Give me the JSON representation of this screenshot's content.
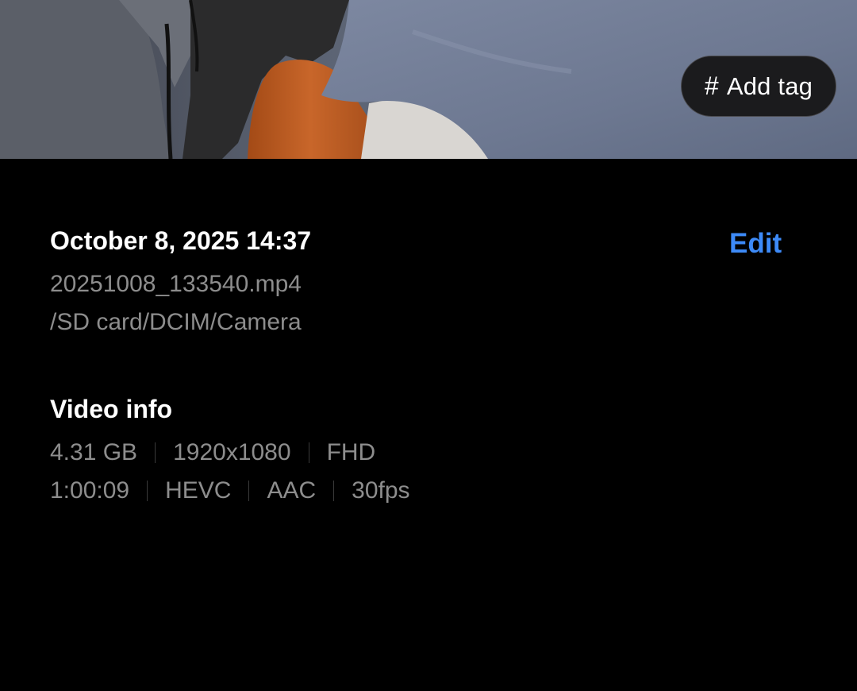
{
  "tag_button": {
    "icon": "hash-icon",
    "label": "Add tag"
  },
  "details": {
    "date_time": "October 8, 2025 14:37",
    "edit_label": "Edit",
    "file_name": "20251008_133540.mp4",
    "path": "/SD card/DCIM/Camera"
  },
  "video_info": {
    "title": "Video info",
    "row1": [
      "4.31 GB",
      "1920x1080",
      "FHD"
    ],
    "row2": [
      "1:00:09",
      "HEVC",
      "AAC",
      "30fps"
    ]
  },
  "colors": {
    "background": "#000000",
    "accent": "#3d8af7",
    "secondary_text": "#8d8d8d",
    "chip_background": "#1b1b1d"
  }
}
